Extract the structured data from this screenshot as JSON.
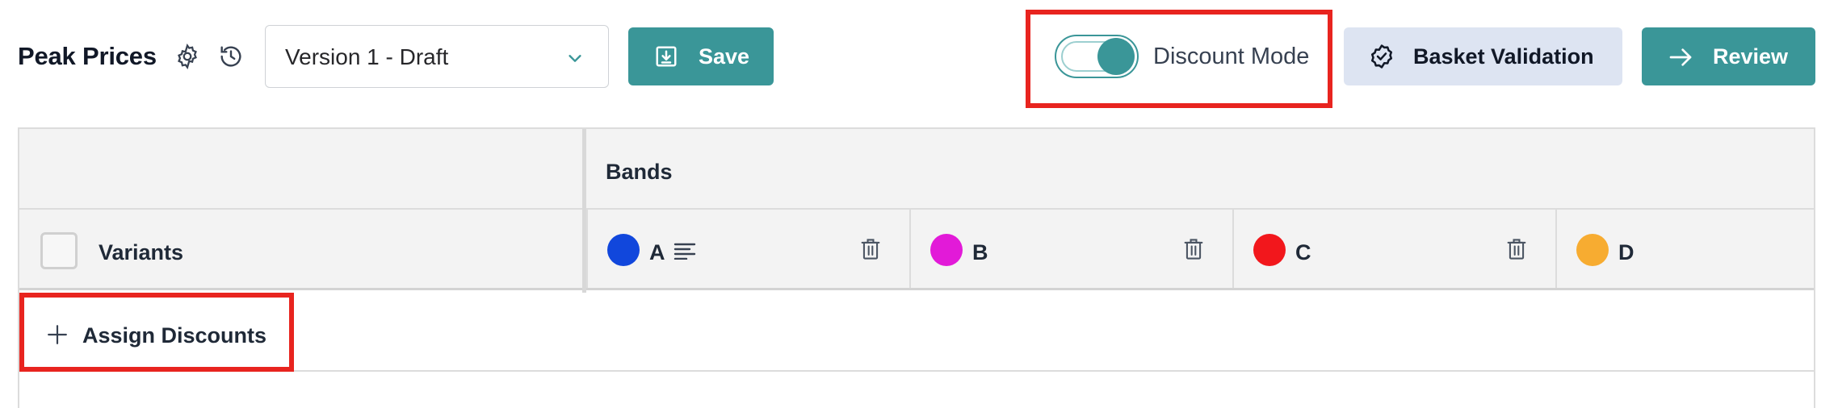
{
  "header": {
    "title": "Peak Prices",
    "settings_icon": "gear-icon",
    "history_icon": "history-icon",
    "version_select": {
      "value": "Version 1 - Draft"
    },
    "save_label": "Save",
    "discount_mode": {
      "label": "Discount Mode",
      "enabled": true
    },
    "basket_validation_label": "Basket Validation",
    "review_label": "Review"
  },
  "grid": {
    "bands_header": "Bands",
    "variants_header": "Variants",
    "bands": [
      {
        "name": "A",
        "color": "#1147dc",
        "has_description": true
      },
      {
        "name": "B",
        "color": "#e21ad8",
        "has_description": false
      },
      {
        "name": "C",
        "color": "#f2171c",
        "has_description": false
      },
      {
        "name": "D",
        "color": "#f7ac31",
        "has_description": false
      }
    ],
    "assign_label": "Assign Discounts"
  },
  "colors": {
    "accent": "#3a9698",
    "secondary_button": "#dde4f2",
    "highlight": "#e8241f"
  }
}
